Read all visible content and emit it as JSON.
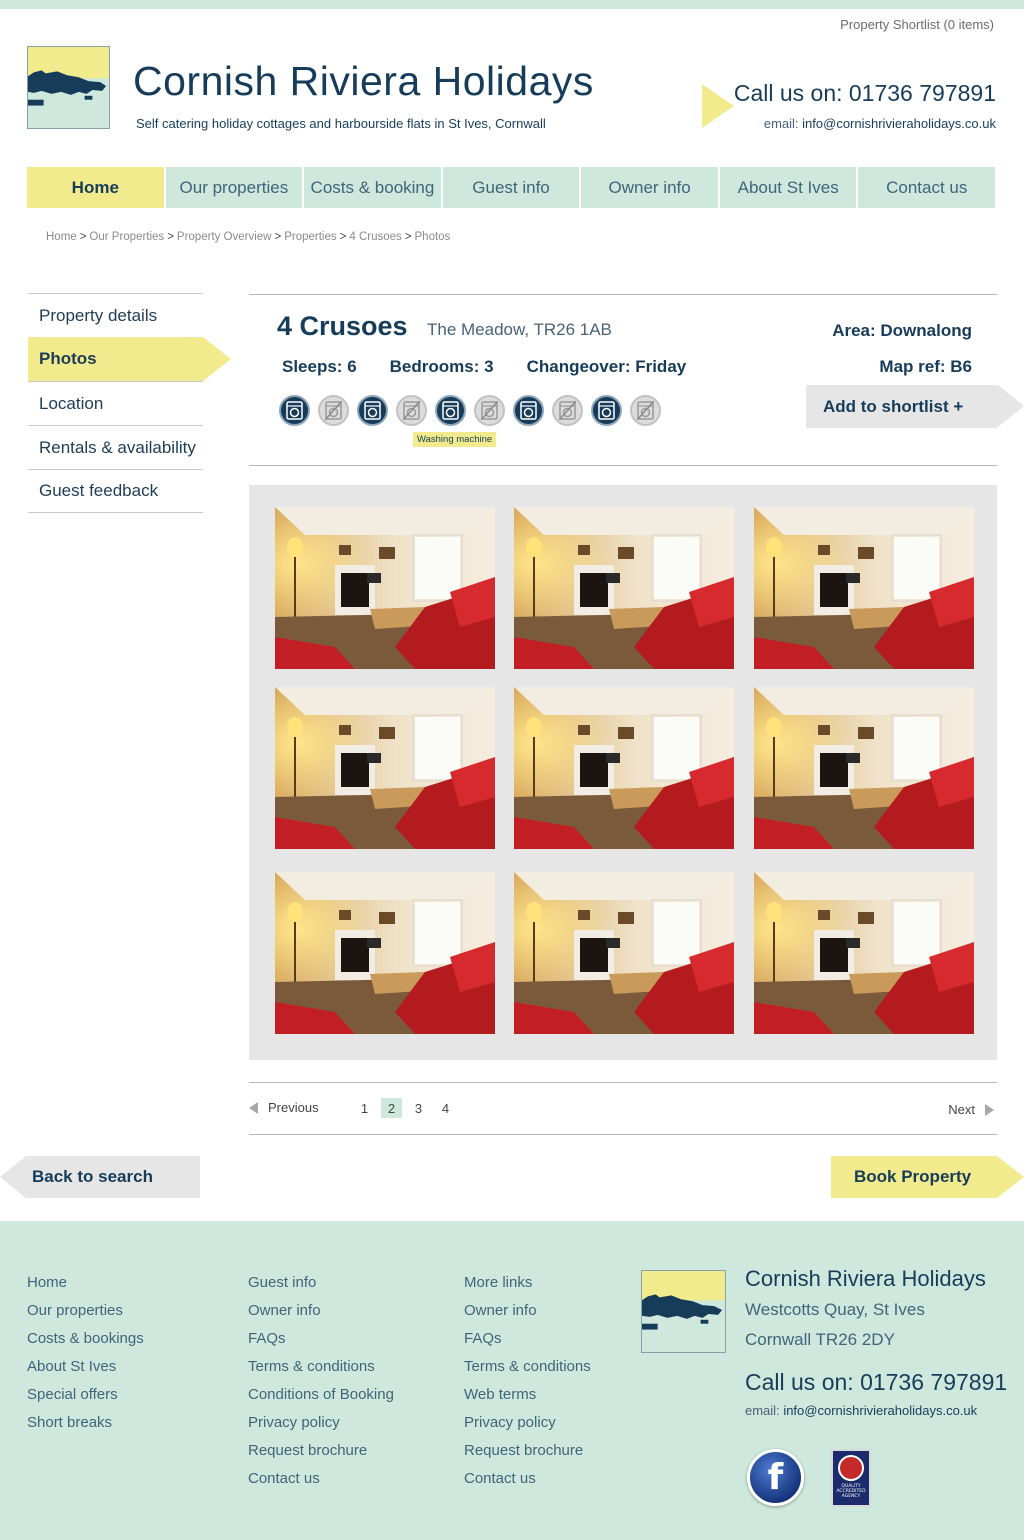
{
  "header": {
    "shortlist_link": "Property Shortlist (0 items)",
    "site_title": "Cornish Riviera Holidays",
    "tagline": "Self catering holiday cottages and harbourside flats in St Ives, Cornwall",
    "call_label": "Call us on:",
    "phone": "01736 797891",
    "email_label": "email:",
    "email": "info@cornishrivieraholidays.co.uk"
  },
  "nav": {
    "items": [
      {
        "label": "Home",
        "active": true
      },
      {
        "label": "Our properties"
      },
      {
        "label": "Costs & booking"
      },
      {
        "label": "Guest info"
      },
      {
        "label": "Owner info"
      },
      {
        "label": "About St Ives"
      },
      {
        "label": "Contact us"
      }
    ]
  },
  "breadcrumb": {
    "items": [
      "Home",
      "Our Properties",
      "Property Overview",
      "Properties",
      "4 Crusoes",
      "Photos"
    ],
    "sep": ">"
  },
  "sidenav": {
    "items": [
      "Property details",
      "Photos",
      "Location",
      "Rentals & availability",
      "Guest feedback"
    ],
    "active_index": 1
  },
  "property": {
    "name": "4 Crusoes",
    "address": "The Meadow, TR26 1AB",
    "area": "Area: Downalong",
    "map_ref": "Map ref: B6",
    "sleeps": "Sleeps: 6",
    "bedrooms": "Bedrooms: 3",
    "changeover": "Changeover: Friday",
    "shortlist_button": "Add to shortlist  +",
    "tooltip": "Washing machine",
    "amenities": [
      {
        "icon": "washing-machine-icon",
        "available": true
      },
      {
        "icon": "washing-machine-unavailable-icon",
        "available": false
      },
      {
        "icon": "washing-machine-icon",
        "available": true
      },
      {
        "icon": "washing-machine-unavailable-icon",
        "available": false
      },
      {
        "icon": "washing-machine-icon",
        "available": true
      },
      {
        "icon": "washing-machine-unavailable-icon",
        "available": false
      },
      {
        "icon": "washing-machine-icon",
        "available": true
      },
      {
        "icon": "washing-machine-unavailable-icon",
        "available": false
      },
      {
        "icon": "washing-machine-icon",
        "available": true
      },
      {
        "icon": "washing-machine-unavailable-icon",
        "available": false
      }
    ]
  },
  "gallery": {
    "photo_count": 9,
    "photo_subject": "living-room-photo"
  },
  "pagination": {
    "previous": "Previous",
    "next": "Next",
    "pages": [
      "1",
      "2",
      "3",
      "4"
    ],
    "current": "2"
  },
  "actions": {
    "back": "Back to search",
    "book": "Book Property"
  },
  "footer": {
    "col1": [
      "Home",
      "Our properties",
      "Costs & bookings",
      "About St Ives",
      "Special offers",
      "Short breaks"
    ],
    "col2": [
      "Guest info",
      "Owner info",
      "FAQs",
      "Terms & conditions",
      "Conditions of Booking",
      "Privacy policy",
      "Request brochure",
      "Contact us"
    ],
    "col3": [
      "More links",
      "Owner info",
      "FAQs",
      "Terms & conditions",
      "Web terms",
      "Privacy policy",
      "Request brochure",
      "Contact us"
    ],
    "company": "Cornish Riviera Holidays",
    "address_line1": "Westcotts Quay, St Ives",
    "address_line2": "Cornwall TR26 2DY",
    "call_label": "Call us on:",
    "phone": "01736 797891",
    "email_label": "email:",
    "email": "info@cornishrivieraholidays.co.uk",
    "facebook_icon_glyph": "f",
    "badge_text": "QUALITY ACCREDITED AGENCY"
  },
  "colors": {
    "mint": "#cfe8dd",
    "yellow": "#f1eb8d",
    "navy": "#173c5a",
    "grey_panel": "#e6e6e6"
  }
}
